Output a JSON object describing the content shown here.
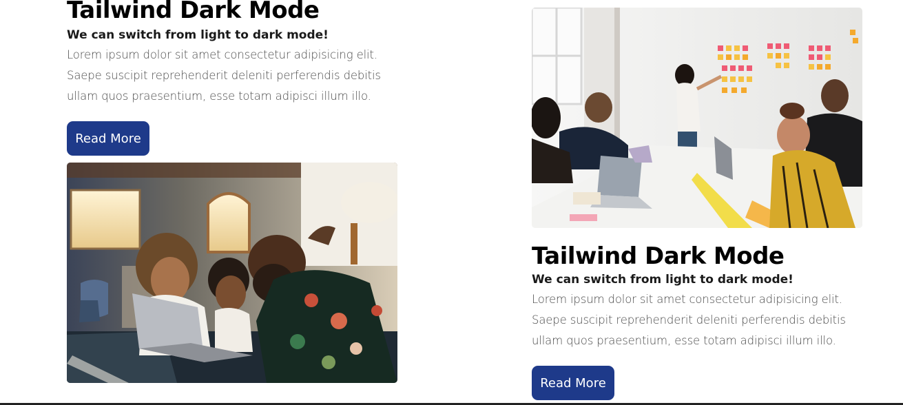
{
  "left_card": {
    "title": "Tailwind Dark Mode",
    "subtitle": "We can switch from light to dark mode!",
    "body_lines": [
      "Lorem ipsum dolor sit amet consectetur adipisicing elit.",
      "Saepe suscipit reprehenderit deleniti perferendis debitis",
      "ullam quos praesentium, esse totam adipisci illum illo."
    ],
    "button_label": "Read More"
  },
  "right_card": {
    "title": "Tailwind Dark Mode",
    "subtitle": "We can switch from light to dark mode!",
    "body_lines": [
      "Lorem ipsum dolor sit amet consectetur adipisicing elit.",
      "Saepe suscipit reprehenderit deleniti perferendis debitis",
      "ullam quos praesentium, esse totam adipisci illum illo."
    ],
    "button_label": "Read More"
  },
  "colors": {
    "button_bg": "#1e3a8a",
    "button_text": "#ffffff",
    "title": "#000000",
    "body": "#4b4b4b"
  }
}
